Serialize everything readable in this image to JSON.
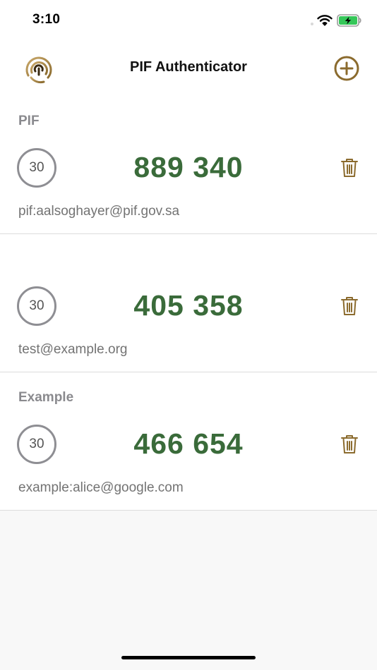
{
  "status_bar": {
    "time": "3:10"
  },
  "header": {
    "title": "PIF Authenticator"
  },
  "accounts": [
    {
      "issuer": "PIF",
      "code": "889 340",
      "seconds_remaining": "30",
      "account": "pif:aalsoghayer@pif.gov.sa"
    },
    {
      "issuer": "",
      "code": "405 358",
      "seconds_remaining": "30",
      "account": "test@example.org"
    },
    {
      "issuer": "Example",
      "code": "466 654",
      "seconds_remaining": "30",
      "account": "example:alice@google.com"
    }
  ],
  "colors": {
    "code_green": "#3a6b3a",
    "accent_gold": "#8b6b2e",
    "label_gray": "#8a8a8e"
  }
}
